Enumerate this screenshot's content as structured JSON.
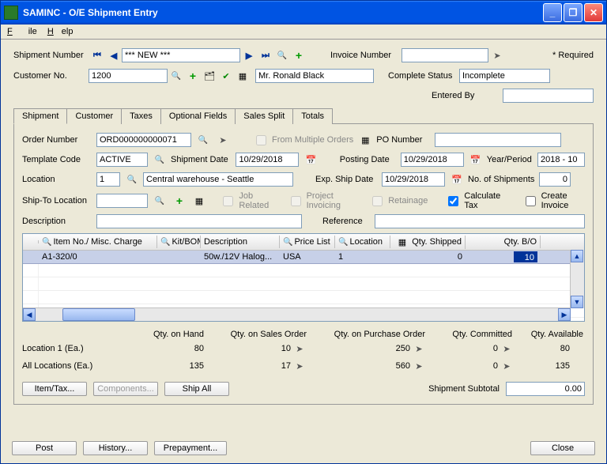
{
  "window": {
    "title": "SAMINC - O/E Shipment Entry"
  },
  "menu": {
    "file": "File",
    "help": "Help"
  },
  "header": {
    "shipment_no_label": "Shipment Number",
    "shipment_no_value": "*** NEW ***",
    "invoice_no_label": "Invoice Number",
    "invoice_no_value": "",
    "required_label": "* Required",
    "cust_no_label": "Customer No.",
    "cust_no_value": "1200",
    "cust_name": "Mr. Ronald Black",
    "complete_status_label": "Complete Status",
    "complete_status_value": "Incomplete",
    "entered_by_label": "Entered By",
    "entered_by_value": ""
  },
  "tabs": [
    "Shipment",
    "Customer",
    "Taxes",
    "Optional Fields",
    "Sales Split",
    "Totals"
  ],
  "shipment": {
    "order_no_label": "Order Number",
    "order_no_value": "ORD000000000071",
    "from_multiple": "From Multiple Orders",
    "po_no_label": "PO Number",
    "po_no_value": "",
    "template_label": "Template Code",
    "template_value": "ACTIVE",
    "ship_date_label": "Shipment Date",
    "ship_date_value": "10/29/2018",
    "post_date_label": "Posting Date",
    "post_date_value": "10/29/2018",
    "year_period_label": "Year/Period",
    "year_period_value": "2018 - 10",
    "location_label": "Location",
    "location_value": "1",
    "location_desc": "Central warehouse - Seattle",
    "exp_ship_label": "Exp. Ship Date",
    "exp_ship_value": "10/29/2018",
    "num_ship_label": "No. of Shipments",
    "num_ship_value": "0",
    "shipto_label": "Ship-To Location",
    "shipto_value": "",
    "job_related": "Job Related",
    "project_inv": "Project Invoicing",
    "retainage": "Retainage",
    "calc_tax": "Calculate Tax",
    "create_inv": "Create Invoice",
    "desc_label": "Description",
    "desc_value": "",
    "ref_label": "Reference",
    "ref_value": ""
  },
  "grid": {
    "headers": [
      "Item No./ Misc. Charge",
      "Kit/BOM",
      "Description",
      "Price List",
      "Location",
      "Qty. Shipped",
      "Qty. B/O"
    ],
    "row": {
      "item": "A1-320/0",
      "kit": "",
      "desc": "50w./12V Halog...",
      "price": "USA",
      "loc": "1",
      "shipped": "0",
      "bo": "10"
    }
  },
  "summary": {
    "headers": [
      "Qty. on Hand",
      "Qty. on Sales Order",
      "Qty. on Purchase Order",
      "Qty. Committed",
      "Qty. Available"
    ],
    "loc_label": "Location    1 (Ea.)",
    "loc": {
      "onhand": "80",
      "sales": "10",
      "po": "250",
      "committed": "0",
      "avail": "80"
    },
    "all_label": "All Locations (Ea.)",
    "all": {
      "onhand": "135",
      "sales": "17",
      "po": "560",
      "committed": "0",
      "avail": "135"
    }
  },
  "buttons": {
    "item_tax": "Item/Tax...",
    "components": "Components...",
    "ship_all": "Ship All",
    "subtotal_label": "Shipment Subtotal",
    "subtotal_value": "0.00",
    "post": "Post",
    "history": "History...",
    "prepayment": "Prepayment...",
    "close": "Close"
  }
}
